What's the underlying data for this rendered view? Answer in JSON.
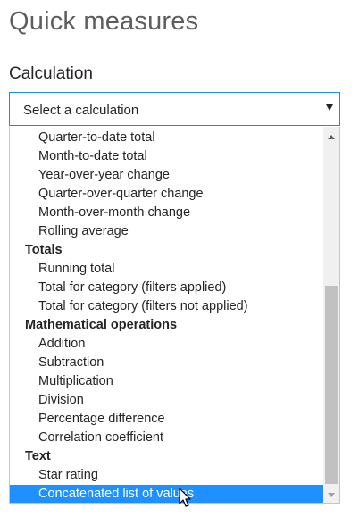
{
  "title": "Quick measures",
  "calculation_label": "Calculation",
  "select": {
    "placeholder": "Select a calculation"
  },
  "list": [
    {
      "type": "item",
      "label": "Quarter-to-date total"
    },
    {
      "type": "item",
      "label": "Month-to-date total"
    },
    {
      "type": "item",
      "label": "Year-over-year change"
    },
    {
      "type": "item",
      "label": "Quarter-over-quarter change"
    },
    {
      "type": "item",
      "label": "Month-over-month change"
    },
    {
      "type": "item",
      "label": "Rolling average"
    },
    {
      "type": "group",
      "label": "Totals"
    },
    {
      "type": "item",
      "label": "Running total"
    },
    {
      "type": "item",
      "label": "Total for category (filters applied)"
    },
    {
      "type": "item",
      "label": "Total for category (filters not applied)"
    },
    {
      "type": "group",
      "label": "Mathematical operations"
    },
    {
      "type": "item",
      "label": "Addition"
    },
    {
      "type": "item",
      "label": "Subtraction"
    },
    {
      "type": "item",
      "label": "Multiplication"
    },
    {
      "type": "item",
      "label": "Division"
    },
    {
      "type": "item",
      "label": "Percentage difference"
    },
    {
      "type": "item",
      "label": "Correlation coefficient"
    },
    {
      "type": "group",
      "label": "Text"
    },
    {
      "type": "item",
      "label": "Star rating"
    },
    {
      "type": "item",
      "label": "Concatenated list of values",
      "selected": true
    }
  ],
  "colors": {
    "accent": "#118dff",
    "selected_bg": "#1e90ff"
  },
  "icons": {
    "dropdown_arrow": "caret-down-icon",
    "scroll_up": "scroll-up-icon",
    "scroll_down": "scroll-down-icon",
    "cursor": "mouse-pointer-icon"
  }
}
